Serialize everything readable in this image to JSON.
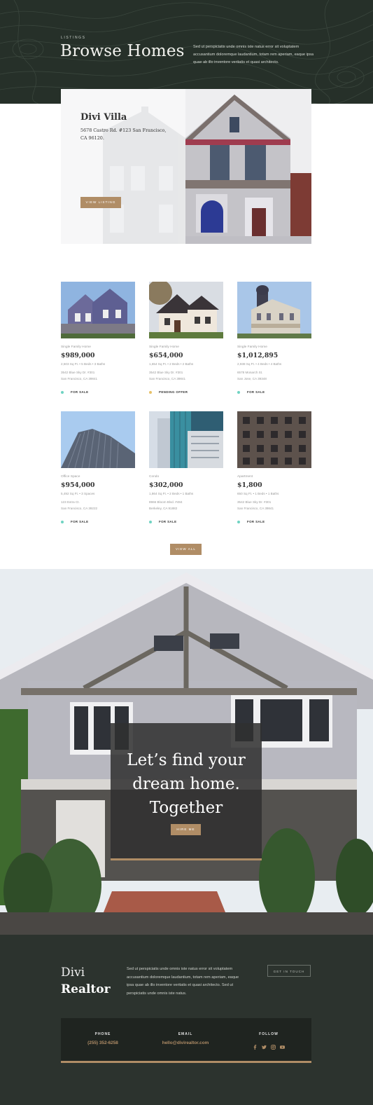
{
  "hero": {
    "eyebrow": "LISTINGS",
    "title": "Browse Homes",
    "description": "Sed ut perspiciatis unde omnis iste natus error sit voluptatem accusantium doloremque laudantium, totam rem aperiam, eaque ipsa quae ab illo inventore veritatis et quasi architecto."
  },
  "featured": {
    "title": "Divi Villa",
    "address": "5678 Castro Rd. #123 San Francisco, CA 96120.",
    "button": "VIEW LISTING"
  },
  "listings": [
    {
      "type": "Single Family Home",
      "price": "$989,000",
      "specs": "2,503 Sq Ft.  •  5 Beds  •  3 Baths",
      "addr1": "3542 Blue Sky Dr. #301",
      "addr2": "San Francisco, CA 39841",
      "status": "FOR SALE",
      "status_color": "#6fd3c2"
    },
    {
      "type": "Single Family Home",
      "price": "$654,000",
      "specs": "1,654 Sq Ft.  •  2 Beds  •  2 Baths",
      "addr1": "3542 Blue Sky Dr. #301",
      "addr2": "San Francisco, CA 39841",
      "status": "PENDING OFFER",
      "status_color": "#e7c168"
    },
    {
      "type": "Single Family Home",
      "price": "$1,012,895",
      "specs": "2,938 Sq Ft.  •  4 Beds  •  4 Baths",
      "addr1": "6578 Monarch St.",
      "addr2": "San Jose, CA 39348",
      "status": "FOR SALE",
      "status_color": "#6fd3c2"
    },
    {
      "type": "Office Space",
      "price": "$954,000",
      "specs": "5,492 Sq Ft.  •  3 Spaces",
      "addr1": "123 Extra Ct.",
      "addr2": "San Francisco, CA 39222",
      "status": "FOR SALE",
      "status_color": "#6fd3c2"
    },
    {
      "type": "Condo",
      "price": "$302,000",
      "specs": "1,864 Sq Ft.  •  2 Beds  •  1 Baths",
      "addr1": "8966 Bloom Blvd. #484",
      "addr2": "Berkeley, CA 91882",
      "status": "FOR SALE",
      "status_color": "#6fd3c2"
    },
    {
      "type": "Apartment",
      "price": "$1,800",
      "specs": "650 Sq Ft.  •  1 Beds  •  1 Baths",
      "addr1": "3542 Blue Sky Dr. #301",
      "addr2": "San Francisco, CA 39841",
      "status": "FOR SALE",
      "status_color": "#6fd3c2"
    }
  ],
  "view_all": "VIEW ALL",
  "cta": {
    "title_line1": "Let’s find your",
    "title_line2": "dream home.",
    "title_line3": "Together",
    "button": "HIRE ME"
  },
  "footer": {
    "brand_line1": "Divi",
    "brand_line2": "Realtor",
    "description": "Sed ut perspiciatis unde omnis iste natus error sit voluptatem accusantium doloremque laudantium, totam rem aperiam, eaque ipsa quae ab illo inventore veritatis et quasi architecto. Sed ut perspiciatis unde omnis iste natus.",
    "touch_button": "GET IN TOUCH",
    "phone_label": "PHONE",
    "phone": "(255) 352-6258",
    "email_label": "EMAIL",
    "email": "hello@divirealtor.com",
    "follow_label": "FOLLOW",
    "socials": [
      "facebook-icon",
      "twitter-icon",
      "instagram-icon",
      "youtube-icon"
    ]
  },
  "colors": {
    "accent": "#b08d66",
    "dark_green": "#263029",
    "footer_bg": "#2c332e",
    "for_sale": "#6fd3c2",
    "pending": "#e7c168"
  }
}
